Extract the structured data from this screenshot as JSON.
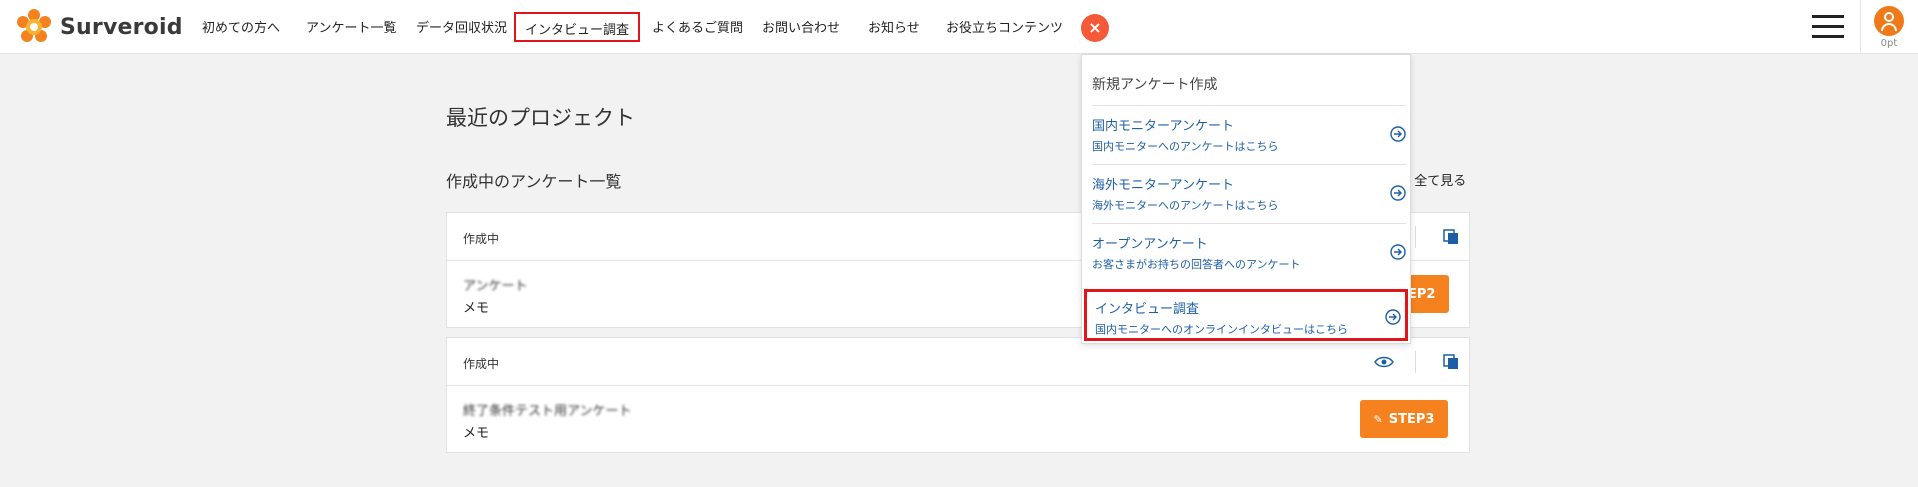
{
  "header": {
    "brand": "Surveroid",
    "nav": [
      {
        "label": "初めての方へ"
      },
      {
        "label": "アンケート一覧"
      },
      {
        "label": "データ回収状況"
      },
      {
        "label": "インタビュー調査"
      },
      {
        "label": "よくあるご質問"
      },
      {
        "label": "お問い合わせ"
      },
      {
        "label": "お知らせ"
      },
      {
        "label": "お役立ちコンテンツ"
      }
    ],
    "close_label": "×",
    "points": "0pt"
  },
  "main": {
    "title": "最近のプロジェクト",
    "section_title": "作成中のアンケート一覧",
    "see_all": "全て見る",
    "cards": [
      {
        "status": "作成中",
        "name": "アンケート",
        "memo": "メモ",
        "step": "STEP2"
      },
      {
        "status": "作成中",
        "name": "終了条件テスト用アンケート",
        "memo": "メモ",
        "step": "STEP3"
      }
    ]
  },
  "dropdown": {
    "heading": "新規アンケート作成",
    "items": [
      {
        "title": "国内モニターアンケート",
        "sub": "国内モニターへのアンケートはこちら"
      },
      {
        "title": "海外モニターアンケート",
        "sub": "海外モニターへのアンケートはこちら"
      },
      {
        "title": "オープンアンケート",
        "sub": "お客さまがお持ちの回答者へのアンケート"
      },
      {
        "title": "インタビュー調査",
        "sub": "国内モニターへのオンラインインタビューはこちら"
      }
    ]
  },
  "colors": {
    "accent_orange": "#f5821f",
    "highlight_red": "#e0161b",
    "link_blue": "#1d5fa7"
  }
}
